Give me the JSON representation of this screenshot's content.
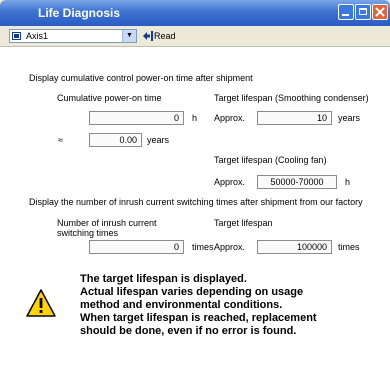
{
  "window": {
    "title": "Life Diagnosis"
  },
  "toolbar": {
    "axis_select": "Axis1",
    "read_label": "Read"
  },
  "power_on": {
    "heading": "Display cumulative control power-on time after shipment",
    "cumulative_label": "Cumulative power-on time",
    "hours_value": "0",
    "hours_unit": "h",
    "approx_symbol": "≈",
    "years_value": "0.00",
    "years_unit": "years",
    "condenser_label": "Target lifespan (Smoothing condenser)",
    "approx_label": "Approx.",
    "condenser_value": "10",
    "condenser_unit": "years",
    "fan_label": "Target lifespan (Cooling fan)",
    "fan_approx_label": "Approx.",
    "fan_value": "50000-70000",
    "fan_unit": "h"
  },
  "inrush": {
    "heading": "Display the number of inrush current switching times after shipment from our factory",
    "count_label_line1": "Number of inrush current",
    "count_label_line2": "switching times",
    "count_value": "0",
    "count_unit": "times",
    "target_label": "Target lifespan",
    "approx_label": "Approx.",
    "target_value": "100000",
    "target_unit": "times"
  },
  "message": {
    "line1": "The target lifespan is displayed.",
    "line2": "Actual lifespan varies depending on usage",
    "line3": "method and environmental conditions.",
    "line4": "When target lifespan is reached, replacement",
    "line5": "should be done, even if no error is found."
  },
  "icons": {
    "warning": "warning-triangle-icon"
  }
}
